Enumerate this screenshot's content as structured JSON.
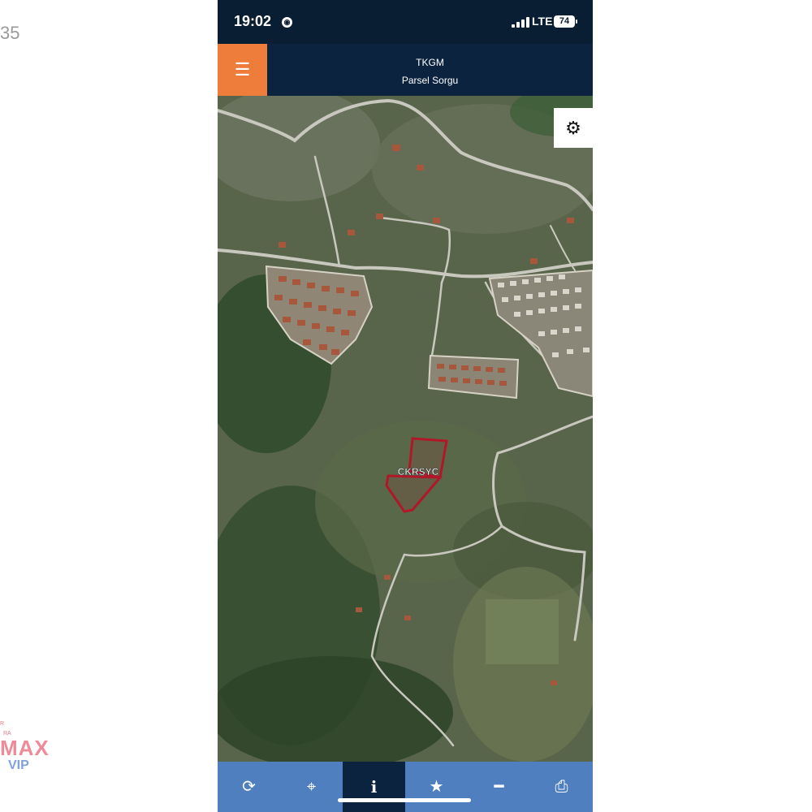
{
  "side": {
    "number": "35"
  },
  "watermark": {
    "small_a": "R",
    "small_b": "RA",
    "brand": "MAX",
    "tier": "VIP"
  },
  "status": {
    "time": "19:02",
    "network": "LTE",
    "battery": "74"
  },
  "app": {
    "title": "TKGM",
    "subtitle": "Parsel Sorgu"
  },
  "map": {
    "parcel_label": "CKRSYC"
  },
  "toolbar": {
    "items": [
      {
        "name": "refresh",
        "glyph": "⟳"
      },
      {
        "name": "locate",
        "glyph": "⌖"
      },
      {
        "name": "info",
        "glyph": "i"
      },
      {
        "name": "favorite",
        "glyph": "★"
      },
      {
        "name": "measure",
        "glyph": "━"
      },
      {
        "name": "print",
        "glyph": "⎙"
      }
    ],
    "active": "info"
  },
  "colors": {
    "accent_orange": "#ee7d3b",
    "navy": "#0c2340",
    "toolbar_blue": "#4f7fbf",
    "parcel": "#b0182a"
  }
}
